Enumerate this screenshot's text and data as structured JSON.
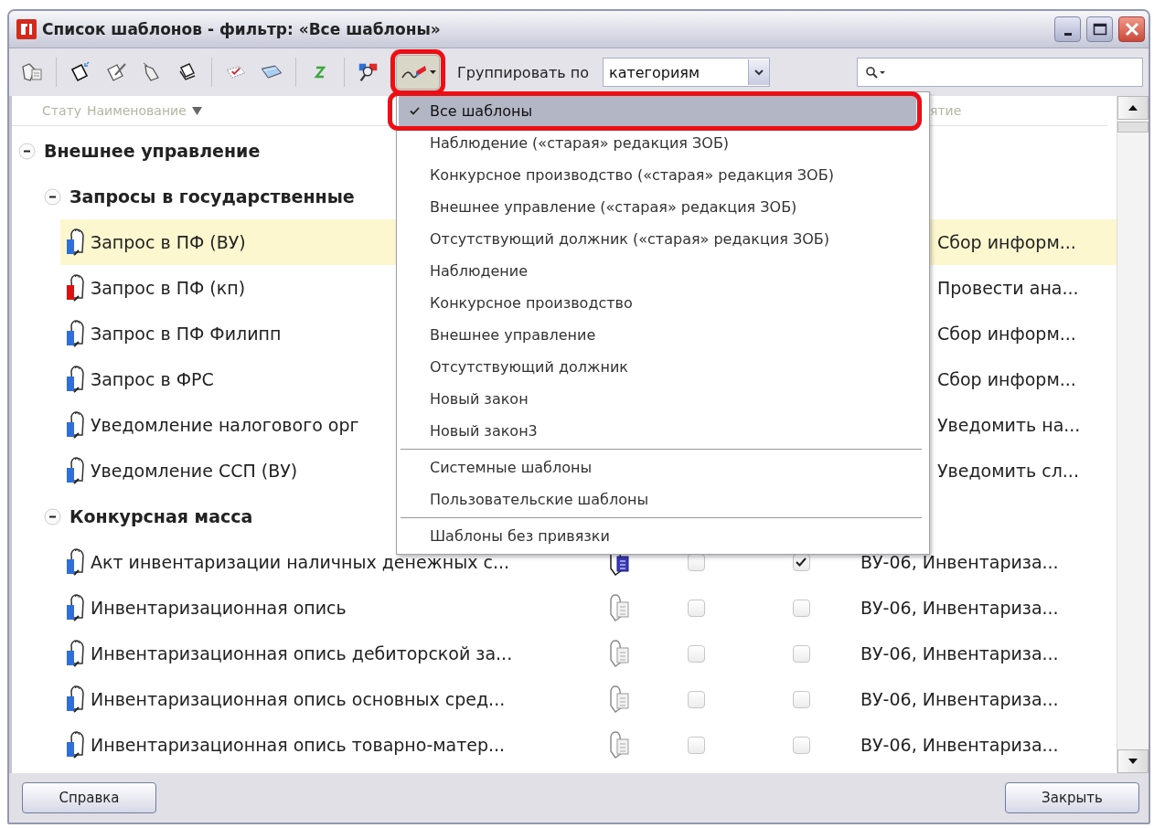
{
  "window": {
    "title": "Список шаблонов - фильтр: «Все шаблоны»"
  },
  "toolbar": {
    "filter_button": {
      "pressed": true,
      "highlighted": true
    },
    "group_by_label": "Группировать по",
    "group_by_select": {
      "value": "категориям"
    }
  },
  "table": {
    "columns": [
      {
        "label": "Стату",
        "sorted": false
      },
      {
        "label": "Наименование",
        "sorted": true
      },
      {
        "label": "ятие",
        "sorted": false
      }
    ],
    "groups": [
      {
        "kind": "group",
        "label": "Внешнее управление",
        "expanded": true,
        "children": [
          {
            "kind": "group",
            "label": "Запросы в государственные",
            "expanded": true,
            "children": [
              {
                "kind": "template",
                "name": "Запрос в ПФ (ВУ)",
                "color": "#2f6fdc",
                "selected": true,
                "task": "Сбор информ..."
              },
              {
                "kind": "template",
                "name": "Запрос в ПФ (кп)",
                "color": "#e01010",
                "selected": false,
                "task": "Провести ана..."
              },
              {
                "kind": "template",
                "name": "Запрос в ПФ Филипп",
                "color": "#2f6fdc",
                "selected": false,
                "task": "Сбор информ..."
              },
              {
                "kind": "template",
                "name": "Запрос в ФРС",
                "color": "#2f6fdc",
                "selected": false,
                "task": "Сбор информ..."
              },
              {
                "kind": "template",
                "name": "Уведомление налогового орг",
                "color": "#2f6fdc",
                "selected": false,
                "task": "Уведомить на..."
              },
              {
                "kind": "template",
                "name": "Уведомление ССП (ВУ)",
                "color": "#2f6fdc",
                "selected": false,
                "task": "Уведомить сл..."
              }
            ]
          },
          {
            "kind": "group",
            "label": "Конкурсная масса",
            "expanded": true,
            "children": [
              {
                "kind": "template",
                "name": "Акт инвентаризации наличных денежных с...",
                "color": "#2f6fdc",
                "selected": false,
                "icon_active": true,
                "check_1": false,
                "check_2": true,
                "task": "ВУ-06, Инвентариза..."
              },
              {
                "kind": "template",
                "name": "Инвентаризационная опись",
                "color": "#2f6fdc",
                "selected": false,
                "icon_active": false,
                "check_1": false,
                "check_2": false,
                "task": "ВУ-06, Инвентариза..."
              },
              {
                "kind": "template",
                "name": "Инвентаризационная опись дебиторской за...",
                "color": "#2f6fdc",
                "selected": false,
                "icon_active": false,
                "check_1": false,
                "check_2": false,
                "task": "ВУ-06, Инвентариза..."
              },
              {
                "kind": "template",
                "name": "Инвентаризационная опись основных сред...",
                "color": "#2f6fdc",
                "selected": false,
                "icon_active": false,
                "check_1": false,
                "check_2": false,
                "task": "ВУ-06, Инвентариза..."
              },
              {
                "kind": "template",
                "name": "Инвентаризационная опись товарно-матер...",
                "color": "#2f6fdc",
                "selected": false,
                "icon_active": false,
                "check_1": false,
                "check_2": false,
                "task": "ВУ-06, Инвентариза..."
              }
            ]
          }
        ]
      }
    ]
  },
  "filter_menu": {
    "items": [
      {
        "kind": "option",
        "label": "Все шаблоны",
        "selected": true,
        "highlighted": true
      },
      {
        "kind": "option",
        "label": "Наблюдение («старая» редакция ЗОБ)",
        "selected": false,
        "highlighted": false
      },
      {
        "kind": "option",
        "label": "Конкурсное производство («старая» редакция ЗОБ)",
        "selected": false,
        "highlighted": false
      },
      {
        "kind": "option",
        "label": "Внешнее управление («старая» редакция ЗОБ)",
        "selected": false,
        "highlighted": false
      },
      {
        "kind": "option",
        "label": "Отсутствующий должник («старая» редакция ЗОБ)",
        "selected": false,
        "highlighted": false
      },
      {
        "kind": "option",
        "label": "Наблюдение",
        "selected": false,
        "highlighted": false
      },
      {
        "kind": "option",
        "label": "Конкурсное производство",
        "selected": false,
        "highlighted": false
      },
      {
        "kind": "option",
        "label": "Внешнее управление",
        "selected": false,
        "highlighted": false
      },
      {
        "kind": "option",
        "label": "Отсутствующий должник",
        "selected": false,
        "highlighted": false
      },
      {
        "kind": "option",
        "label": "Новый закон",
        "selected": false,
        "highlighted": false
      },
      {
        "kind": "option",
        "label": "Новый закон3",
        "selected": false,
        "highlighted": false
      },
      {
        "kind": "separator"
      },
      {
        "kind": "option",
        "label": "Системные шаблоны",
        "selected": false,
        "highlighted": false
      },
      {
        "kind": "option",
        "label": "Пользовательские шаблоны",
        "selected": false,
        "highlighted": false
      },
      {
        "kind": "separator"
      },
      {
        "kind": "option",
        "label": "Шаблоны без привязки",
        "selected": false,
        "highlighted": false
      }
    ]
  },
  "footer": {
    "buttons": [
      "Справка",
      "Закрыть"
    ]
  }
}
